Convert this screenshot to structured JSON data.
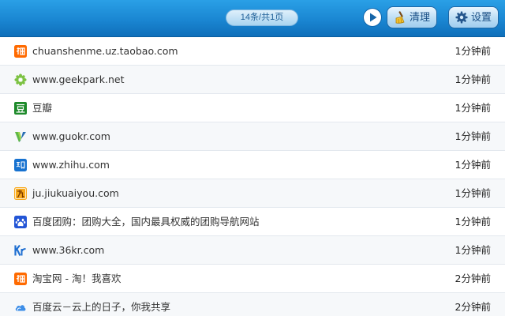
{
  "toolbar": {
    "page_info": "14条/共1页",
    "clean_label": "清理",
    "settings_label": "设置"
  },
  "history": [
    {
      "icon": "taobao-icon",
      "title": "chuanshenme.uz.taobao.com",
      "time": "1分钟前"
    },
    {
      "icon": "geekpark-icon",
      "title": "www.geekpark.net",
      "time": "1分钟前"
    },
    {
      "icon": "douban-icon",
      "title": "豆瓣",
      "time": "1分钟前"
    },
    {
      "icon": "guokr-icon",
      "title": "www.guokr.com",
      "time": "1分钟前"
    },
    {
      "icon": "zhihu-icon",
      "title": "www.zhihu.com",
      "time": "1分钟前"
    },
    {
      "icon": "jiukuaiyou-icon",
      "title": "ju.jiukuaiyou.com",
      "time": "1分钟前"
    },
    {
      "icon": "baidu-paw-icon",
      "title": "百度团购：团购大全，国内最具权威的团购导航网站",
      "time": "1分钟前"
    },
    {
      "icon": "36kr-icon",
      "title": "www.36kr.com",
      "time": "1分钟前"
    },
    {
      "icon": "taobao-icon",
      "title": "淘宝网 - 淘！我喜欢",
      "time": "2分钟前"
    },
    {
      "icon": "baidu-cloud-icon",
      "title": "百度云－云上的日子，你我共享",
      "time": "2分钟前"
    }
  ],
  "colors": {
    "toolbar_top": "#2aa0e6",
    "toolbar_bottom": "#0f6fba",
    "row_alt": "#f6f8fa"
  }
}
